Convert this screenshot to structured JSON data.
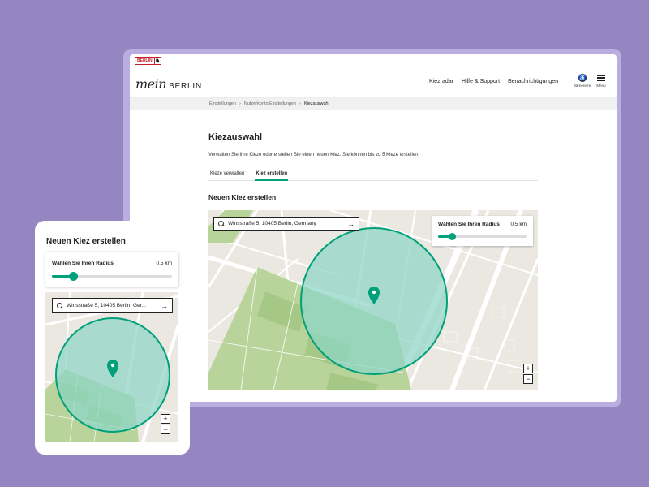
{
  "desktop": {
    "header_badge": "BERLIN",
    "logo": {
      "script": "mein",
      "word": "BERLIN"
    },
    "nav_links": [
      "Kiezradar",
      "Hilfe & Support",
      "Benachrichtigungen"
    ],
    "nav_icons": [
      {
        "icon": "accessibility-icon",
        "label": "Barrierefrei"
      },
      {
        "icon": "menu-icon",
        "label": "Menu"
      }
    ],
    "breadcrumb": [
      "Einstellungen",
      "Nutzerkonto Einstellungen",
      "Kiezauswahl"
    ],
    "page_title": "Kiezauswahl",
    "intro": "Verwalten Sie Ihre Kieze oder erstellen Sie einen neuen Kiez. Sie können bis zu 5 Kieze erstellen.",
    "tabs": [
      {
        "label": "Kieze verwalten",
        "active": false
      },
      {
        "label": "Kiez erstellen",
        "active": true
      }
    ],
    "section_title": "Neuen Kiez erstellen",
    "search": {
      "value": "Winsstraße 5, 10405 Berlin, Germany"
    },
    "radius": {
      "label": "Wählen Sie Ihren Radius",
      "value": "0,5 km",
      "fraction": 0.15
    }
  },
  "mobile": {
    "title": "Neuen Kiez erstellen",
    "radius": {
      "label": "Wählen Sie Ihren Radius",
      "value": "0,5 km",
      "fraction": 0.17
    },
    "search": {
      "value": "Winsstraße 5, 10405 Berlin, Ger..."
    }
  },
  "map": {
    "zoom_in": "+",
    "zoom_out": "−",
    "accent_color": "#00a07a",
    "circle_fill": "#8ed6c6",
    "park_color": "#b8d49a",
    "road_color": "#ffffff",
    "land_color": "#ebe8e1"
  }
}
